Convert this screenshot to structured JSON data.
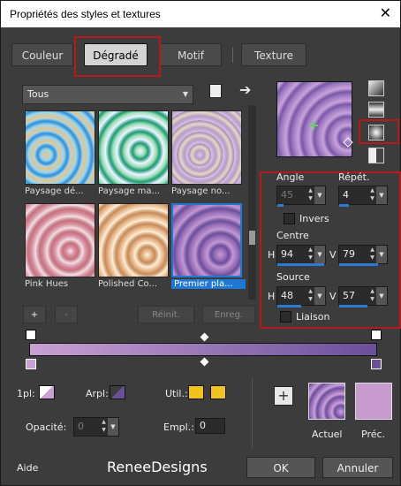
{
  "window": {
    "title": "Propriétés des styles et textures",
    "close": "✕"
  },
  "tabs": [
    {
      "label": "Couleur"
    },
    {
      "label": "Dégradé"
    },
    {
      "label": "Motif"
    },
    {
      "label": "Texture"
    }
  ],
  "category": {
    "value": "Tous"
  },
  "thumbnails": [
    {
      "label": "Paysage dé..."
    },
    {
      "label": "Paysage ma..."
    },
    {
      "label": "Paysage no..."
    },
    {
      "label": "Pink Hues"
    },
    {
      "label": "Polished Co..."
    },
    {
      "label": "Premier pla..."
    }
  ],
  "list_buttons": {
    "add": "+",
    "remove": "-",
    "reset": "Réinit.",
    "save": "Enreg."
  },
  "params": {
    "angle_label": "Angle",
    "angle_value": "45",
    "repeat_label": "Répét.",
    "repeat_value": "4",
    "invert_label": "Invers",
    "center_label": "Centre",
    "center_h_label": "H",
    "center_h": "94",
    "center_v_label": "V",
    "center_v": "79",
    "source_label": "Source",
    "source_h_label": "H",
    "source_h": "48",
    "source_v_label": "V",
    "source_v": "57",
    "link_label": "Liaison",
    "center_h_fill": 0.94,
    "center_v_fill": 0.79,
    "source_h_fill": 0.48,
    "source_v_fill": 0.57,
    "repeat_fill": 0.2,
    "angle_fill": 0.13
  },
  "bottom": {
    "fg_label": "1pl:",
    "bg_label": "Arpl:",
    "use_label": "Util.:",
    "opacity_label": "Opacité:",
    "opacity_value": "0",
    "location_label": "Empl.:",
    "location_value": "0",
    "add": "+",
    "current_label": "Actuel",
    "previous_label": "Préc."
  },
  "footer": {
    "help": "Aide",
    "brand": "ReneeDesigns",
    "ok": "OK",
    "cancel": "Annuler"
  },
  "colors": {
    "accent": "#1e78d4",
    "highlight": "#b5191a",
    "gradient_start": "#c9a0d2",
    "gradient_end": "#6a4f9a",
    "use_color": "#f2c21e",
    "prev_color": "#c89bd0"
  }
}
